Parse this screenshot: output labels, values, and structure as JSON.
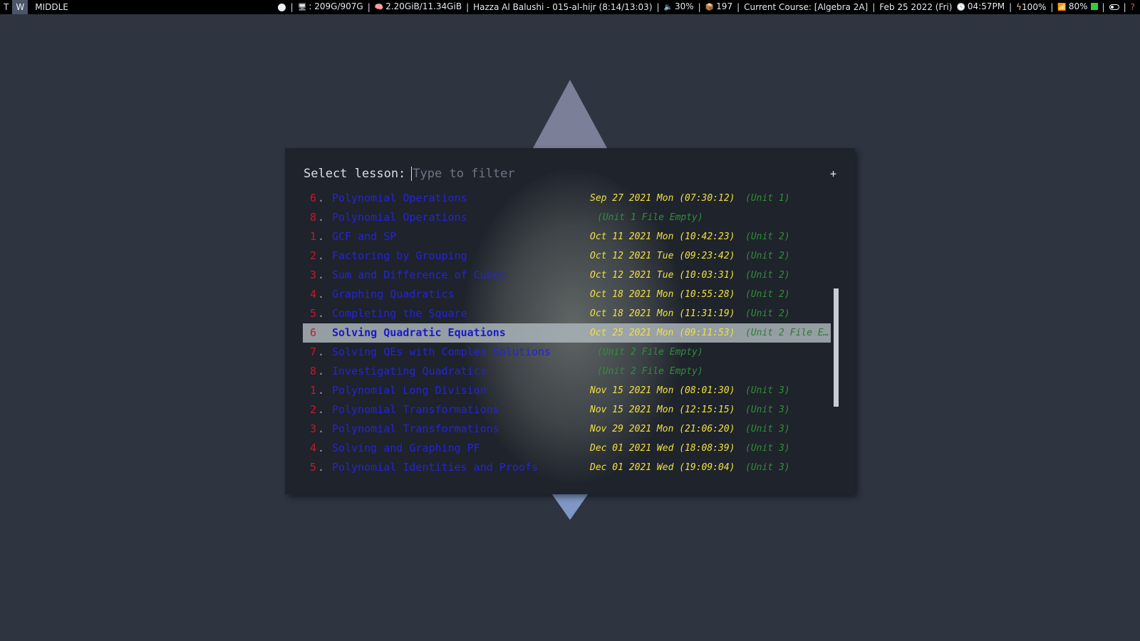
{
  "topbar": {
    "workspaces": [
      "T",
      "W"
    ],
    "active_workspace": "W",
    "layout": "MIDDLE",
    "disk": ": 209G/907G",
    "memory": "2.20GiB/11.34GiB",
    "user_time": "Hazza Al Balushi - 015-al-hijr (8:14/13:03)",
    "volume": "30%",
    "updates": "197",
    "course": "Current Course: [Algebra 2A]",
    "date": "Feb 25 2022 (Fri)",
    "time": "04:57PM",
    "battery": "100%",
    "brightness": "80%",
    "question": "?"
  },
  "launcher": {
    "prompt": "Select lesson:",
    "placeholder": "Type to filter",
    "plus": "+",
    "dot": ".",
    "selected_index": 7,
    "items": [
      {
        "num": "6",
        "title": "Polynomial Operations",
        "date": "Sep 27 2021 Mon (07:30:12)",
        "unit": "(Unit 1)"
      },
      {
        "num": "8",
        "title": "Polynomial Operations",
        "date": "",
        "unit": "(Unit 1 File Empty)"
      },
      {
        "num": "1",
        "title": "GCF and SP",
        "date": "Oct 11 2021 Mon (10:42:23)",
        "unit": "(Unit 2)"
      },
      {
        "num": "2",
        "title": "Factoring by Grouping",
        "date": "Oct 12 2021 Tue (09:23:42)",
        "unit": "(Unit 2)"
      },
      {
        "num": "3",
        "title": "Sum and Difference of Cubes",
        "date": "Oct 12 2021 Tue (10:03:31)",
        "unit": "(Unit 2)"
      },
      {
        "num": "4",
        "title": "Graphing Quadratics",
        "date": "Oct 18 2021 Mon (10:55:28)",
        "unit": "(Unit 2)"
      },
      {
        "num": "5",
        "title": "Completing the Square",
        "date": "Oct 18 2021 Mon (11:31:19)",
        "unit": "(Unit 2)"
      },
      {
        "num": "6",
        "title": "Solving Quadratic Equations",
        "date": "Oct 25 2021 Mon (09:11:53)",
        "unit": "(Unit 2 File E…"
      },
      {
        "num": "7",
        "title": "Solving QEs with Complex Solutions",
        "date": "",
        "unit": "(Unit 2 File Empty)"
      },
      {
        "num": "8",
        "title": "Investigating Quadratics",
        "date": "",
        "unit": "(Unit 2 File Empty)"
      },
      {
        "num": "1",
        "title": "Polynomial Long Division",
        "date": "Nov 15 2021 Mon (08:01:30)",
        "unit": "(Unit 3)"
      },
      {
        "num": "2",
        "title": "Polynomial Transformations",
        "date": "Nov 15 2021 Mon (12:15:15)",
        "unit": "(Unit 3)"
      },
      {
        "num": "3",
        "title": "Polynomial Transformations",
        "date": "Nov 29 2021 Mon (21:06:20)",
        "unit": "(Unit 3)"
      },
      {
        "num": "4",
        "title": "Solving and Graphing PF",
        "date": "Dec 01 2021 Wed (18:08:39)",
        "unit": "(Unit 3)"
      },
      {
        "num": "5",
        "title": "Polynomial Identities and Proofs",
        "date": "Dec 01 2021 Wed (19:09:04)",
        "unit": "(Unit 3)"
      }
    ]
  }
}
